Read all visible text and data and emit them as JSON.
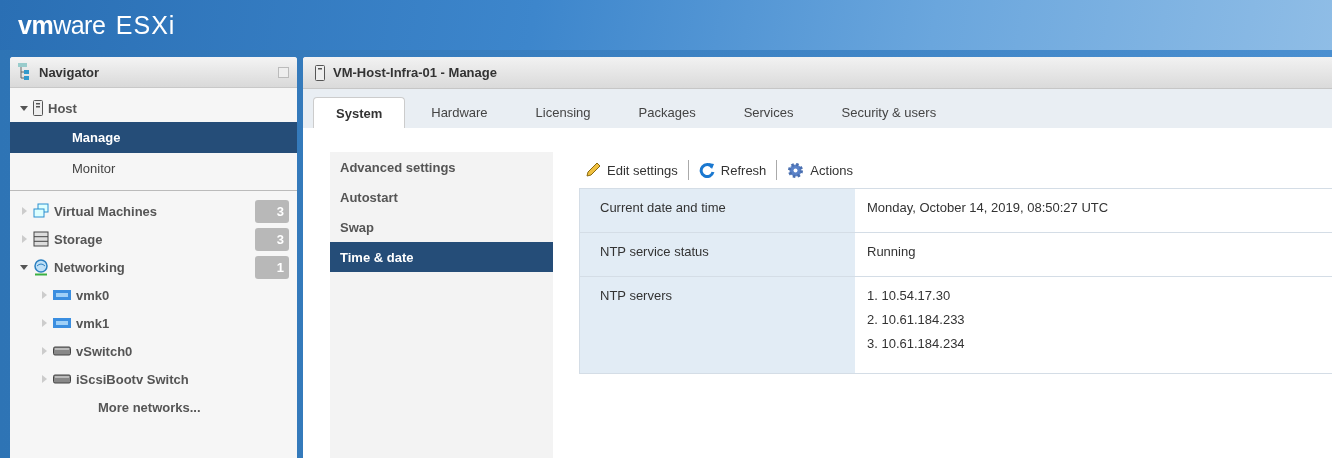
{
  "logo": {
    "brand_bold": "vm",
    "brand_rest": "ware",
    "product": "ESXi"
  },
  "navigator": {
    "title": "Navigator",
    "groups": [
      [
        {
          "label": "Host",
          "kind": "host",
          "expanded": true,
          "children": [
            {
              "label": "Manage",
              "selected": true
            },
            {
              "label": "Monitor",
              "selected": false
            }
          ]
        }
      ],
      [
        {
          "label": "Virtual Machines",
          "kind": "vms",
          "expanded": false,
          "count": "3"
        },
        {
          "label": "Storage",
          "kind": "storage",
          "expanded": false,
          "count": "3"
        },
        {
          "label": "Networking",
          "kind": "network",
          "expanded": true,
          "count": "1",
          "children": [
            {
              "label": "vmk0",
              "kind": "vmknic"
            },
            {
              "label": "vmk1",
              "kind": "vmknic"
            },
            {
              "label": "vSwitch0",
              "kind": "vswitch"
            },
            {
              "label": "iScsiBootv Switch",
              "kind": "vswitch"
            },
            {
              "label": "More networks...",
              "kind": "link"
            }
          ]
        }
      ]
    ]
  },
  "panel": {
    "title": "VM-Host-Infra-01 - Manage",
    "tabs": [
      {
        "label": "System",
        "selected": true
      },
      {
        "label": "Hardware",
        "selected": false
      },
      {
        "label": "Licensing",
        "selected": false
      },
      {
        "label": "Packages",
        "selected": false
      },
      {
        "label": "Services",
        "selected": false
      },
      {
        "label": "Security & users",
        "selected": false
      }
    ],
    "side_menu": [
      {
        "label": "Advanced settings",
        "selected": false
      },
      {
        "label": "Autostart",
        "selected": false
      },
      {
        "label": "Swap",
        "selected": false
      },
      {
        "label": "Time & date",
        "selected": true
      }
    ],
    "toolbar": [
      {
        "label": "Edit settings",
        "kind": "edit"
      },
      {
        "label": "Refresh",
        "kind": "refresh"
      },
      {
        "label": "Actions",
        "kind": "actions"
      }
    ],
    "rows": [
      {
        "label": "Current date and time",
        "values": [
          "Monday, October 14, 2019, 08:50:27 UTC"
        ]
      },
      {
        "label": "NTP service status",
        "values": [
          "Running"
        ]
      },
      {
        "label": "NTP servers",
        "values": [
          "1. 10.54.17.30",
          "2. 10.61.184.233",
          "3. 10.61.184.234"
        ]
      }
    ]
  }
}
